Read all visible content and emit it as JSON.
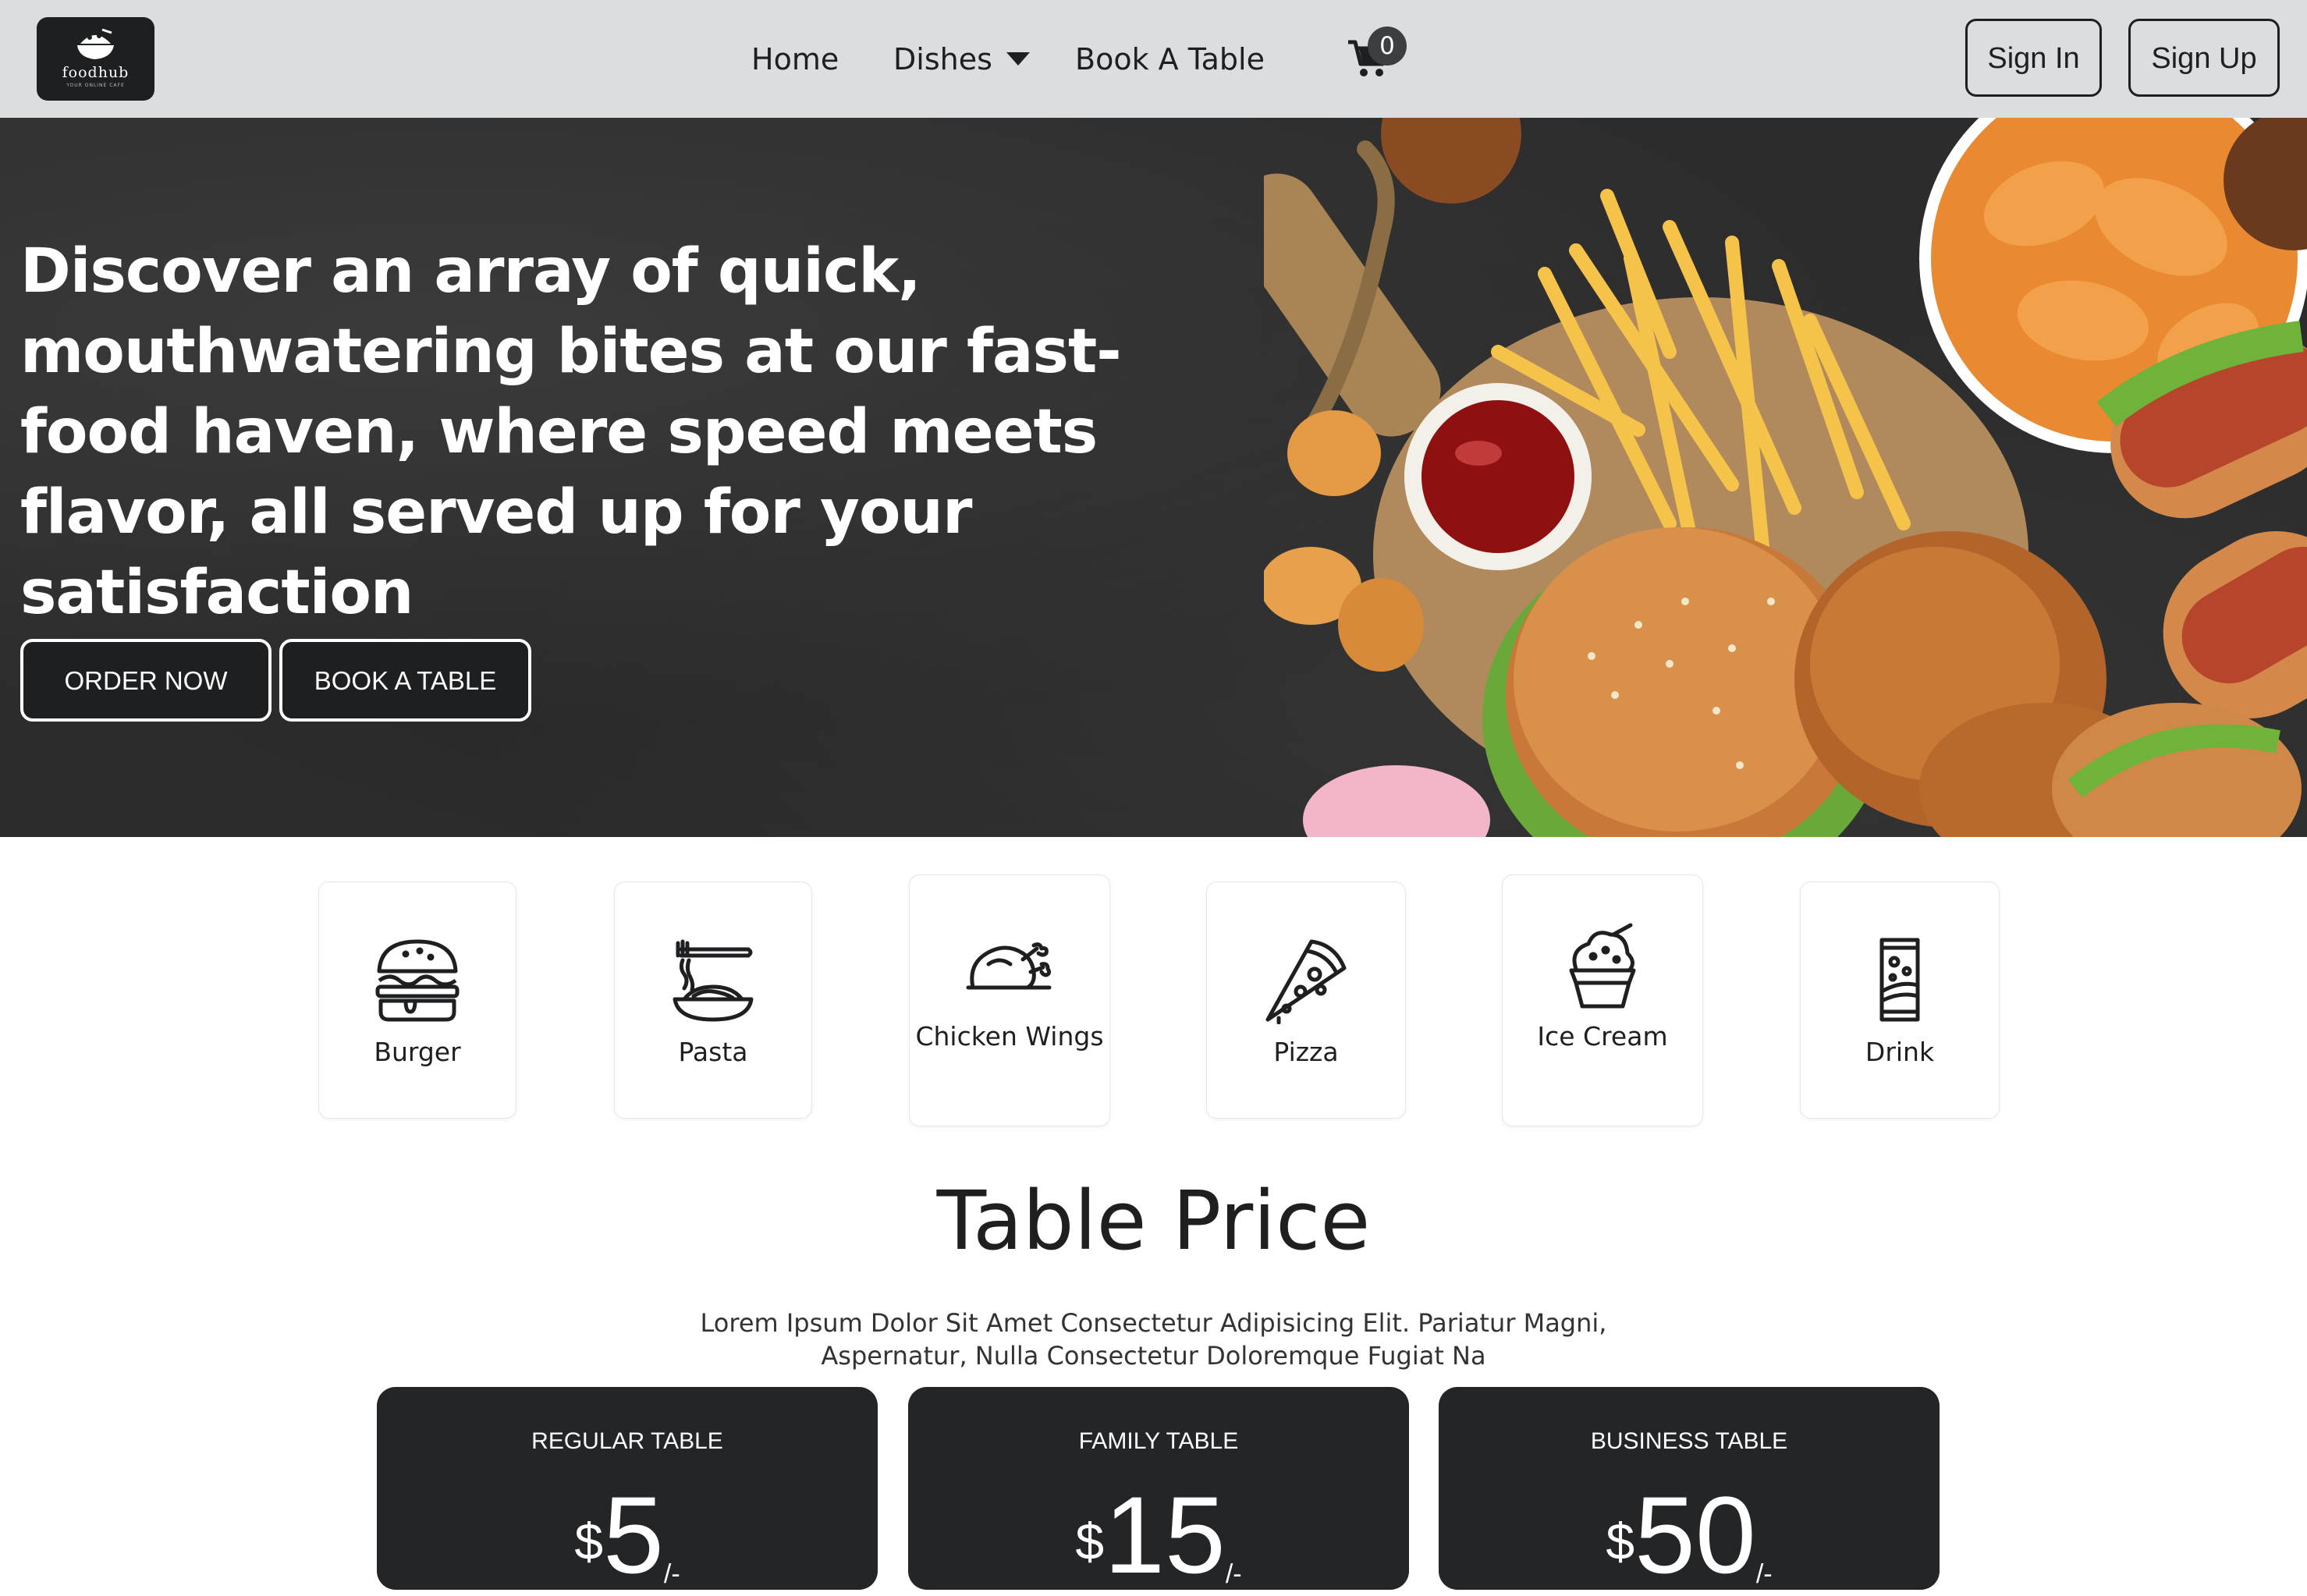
{
  "navbar": {
    "logo": {
      "name": "foodhub",
      "tagline": "YOUR ONLINE CAFE"
    },
    "links": [
      "Home",
      "Dishes",
      "Book A Table"
    ],
    "cart_count": "0",
    "sign_in": "Sign In",
    "sign_up": "Sign Up"
  },
  "hero": {
    "title": "Discover an array of quick, mouthwatering bites at our fast-food haven, where speed meets flavor, all served up for your satisfaction",
    "order_button": "ORDER NOW",
    "book_button": "BOOK A TABLE"
  },
  "categories": [
    {
      "label": "Burger",
      "icon": "burger-icon"
    },
    {
      "label": "Pasta",
      "icon": "pasta-icon"
    },
    {
      "label": "Chicken Wings",
      "icon": "chicken-icon"
    },
    {
      "label": "Pizza",
      "icon": "pizza-icon"
    },
    {
      "label": "Ice Cream",
      "icon": "ice-cream-icon"
    },
    {
      "label": "Drink",
      "icon": "drink-can-icon"
    }
  ],
  "table_price": {
    "title": "Table Price",
    "description": "Lorem Ipsum Dolor Sit Amet Consectetur Adipisicing Elit. Pariatur Magni, Aspernatur, Nulla Consectetur Doloremque Fugiat Na",
    "cards": [
      {
        "name": "REGULAR TABLE",
        "currency": "$",
        "amount": "5",
        "suffix": "/-"
      },
      {
        "name": "FAMILY TABLE",
        "currency": "$",
        "amount": "15",
        "suffix": "/-"
      },
      {
        "name": "BUSINESS TABLE",
        "currency": "$",
        "amount": "50",
        "suffix": "/-"
      }
    ]
  },
  "colors": {
    "navbar_bg": "#dcdddf",
    "dark": "#1e1f21",
    "card_dark": "#242527",
    "hero_bg": "#2c2c2c"
  }
}
